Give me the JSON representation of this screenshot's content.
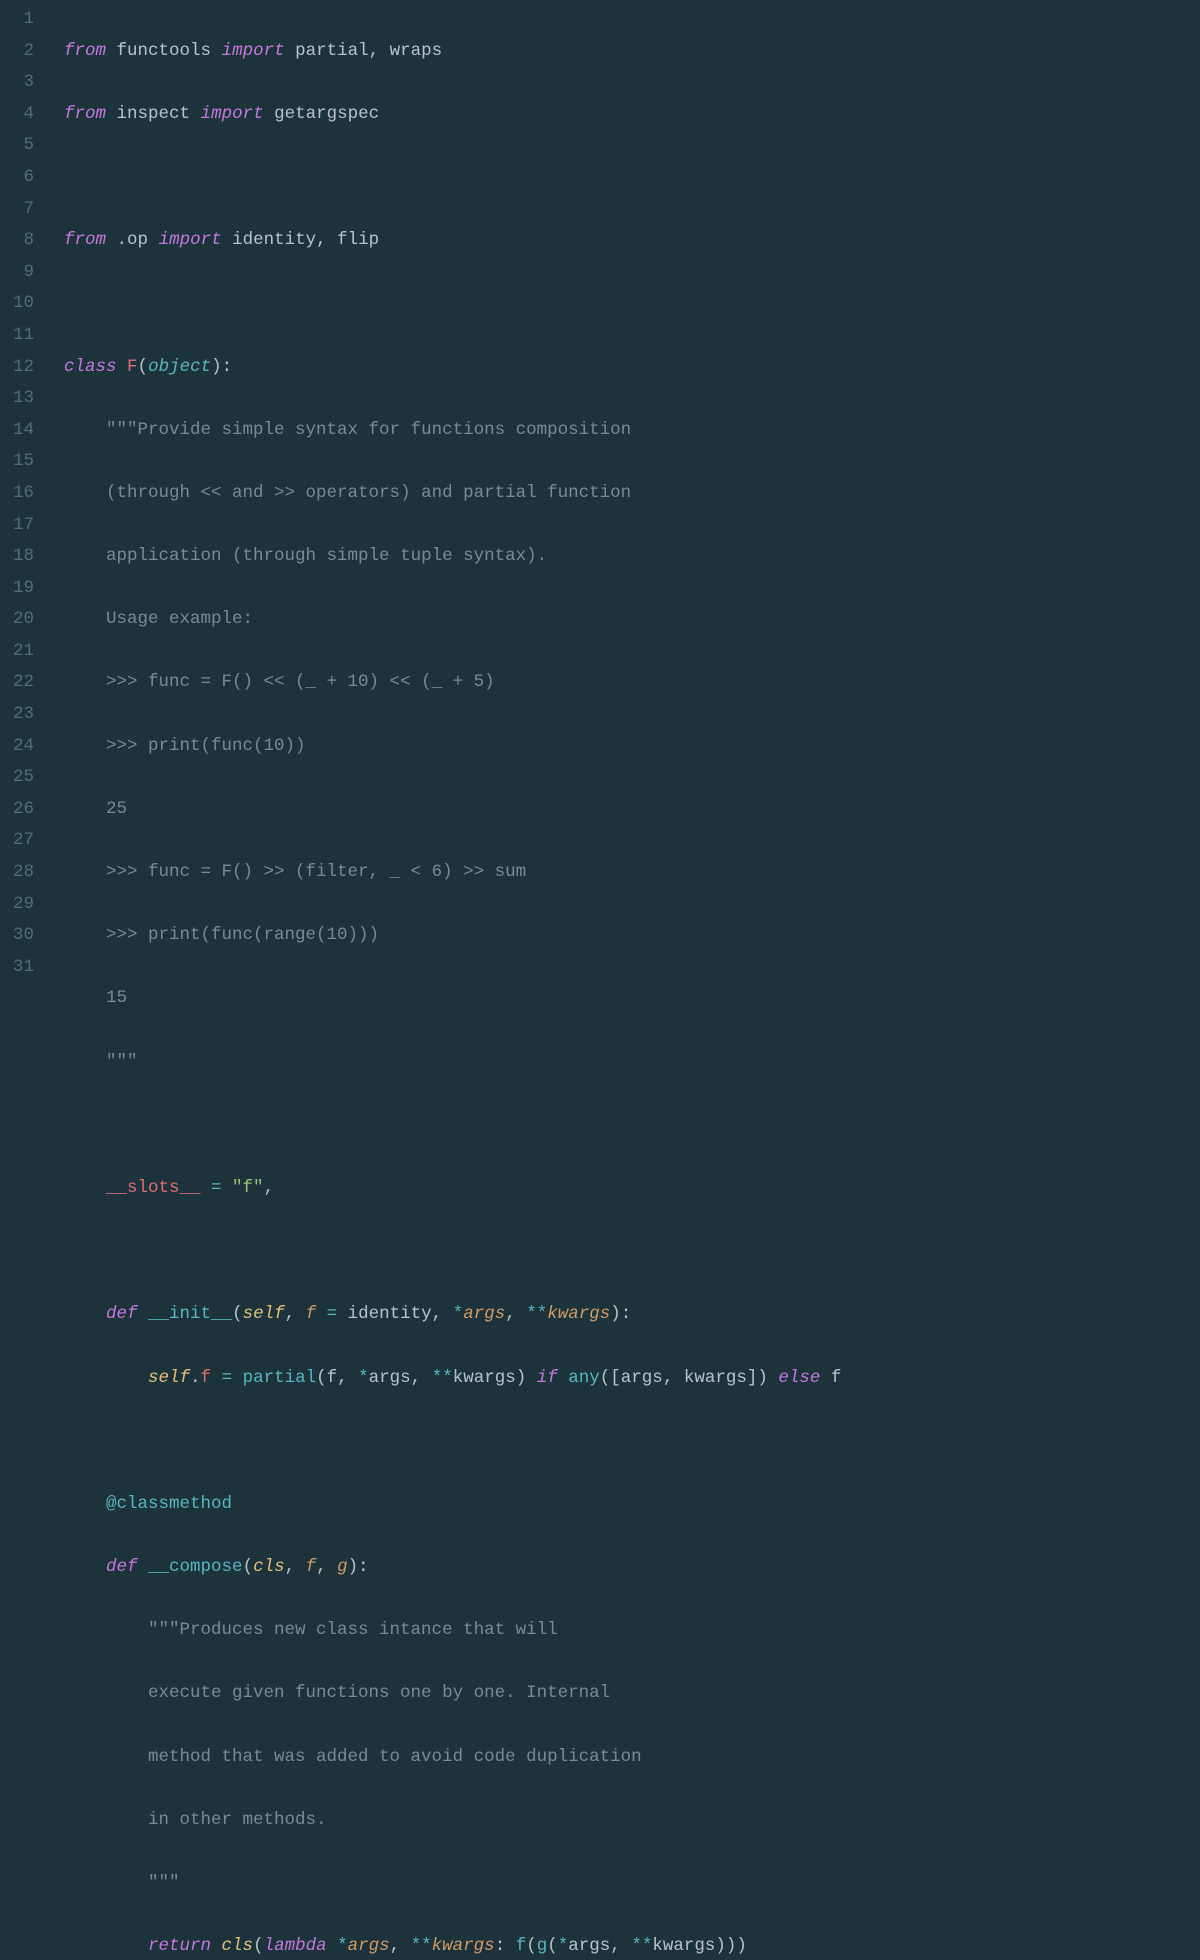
{
  "theme": {
    "background": "#1d333b",
    "gutter_fg": "#516d76",
    "keyword": "#c678dd",
    "function": "#56b6c2",
    "class_name": "#e06c75",
    "param": "#d19a66",
    "self": "#e5c07b",
    "string_doc": "#7a8a91",
    "string": "#98c379"
  },
  "line_numbers": [
    "1",
    "2",
    "3",
    "4",
    "5",
    "6",
    "7",
    "8",
    "9",
    "10",
    "11",
    "12",
    "13",
    "14",
    "15",
    "16",
    "17",
    "18",
    "19",
    "20",
    "21",
    "22",
    "23",
    "24",
    "25",
    "26",
    "27",
    "28",
    "29",
    "30",
    "31"
  ],
  "code_lines": {
    "l1": {
      "text": "from functools import partial, wraps"
    },
    "l2": {
      "text": "from inspect import getargspec"
    },
    "l3": {
      "text": ""
    },
    "l4": {
      "text": "from .op import identity, flip"
    },
    "l5": {
      "text": ""
    },
    "l6": {
      "text": "class F(object):"
    },
    "l7": {
      "text": "    \"\"\"Provide simple syntax for functions composition"
    },
    "l8": {
      "text": "    (through << and >> operators) and partial function"
    },
    "l9": {
      "text": "    application (through simple tuple syntax)."
    },
    "l10": {
      "text": "    Usage example:"
    },
    "l11": {
      "text": "    >>> func = F() << (_ + 10) << (_ + 5)"
    },
    "l12": {
      "text": "    >>> print(func(10))"
    },
    "l13": {
      "text": "    25"
    },
    "l14": {
      "text": "    >>> func = F() >> (filter, _ < 6) >> sum"
    },
    "l15": {
      "text": "    >>> print(func(range(10)))"
    },
    "l16": {
      "text": "    15"
    },
    "l17": {
      "text": "    \"\"\""
    },
    "l18": {
      "text": ""
    },
    "l19": {
      "text": "    __slots__ = \"f\","
    },
    "l20": {
      "text": ""
    },
    "l21": {
      "text": "    def __init__(self, f = identity, *args, **kwargs):"
    },
    "l22": {
      "text": "        self.f = partial(f, *args, **kwargs) if any([args, kwargs]) else f"
    },
    "l23": {
      "text": ""
    },
    "l24": {
      "text": "    @classmethod"
    },
    "l25": {
      "text": "    def __compose(cls, f, g):"
    },
    "l26": {
      "text": "        \"\"\"Produces new class intance that will"
    },
    "l27": {
      "text": "        execute given functions one by one. Internal"
    },
    "l28": {
      "text": "        method that was added to avoid code duplication"
    },
    "l29": {
      "text": "        in other methods."
    },
    "l30": {
      "text": "        \"\"\""
    },
    "l31": {
      "text": "        return cls(lambda *args, **kwargs: f(g(*args, **kwargs)))"
    }
  },
  "tokens": {
    "from": "from",
    "import": "import",
    "class": "class",
    "def": "def",
    "return": "return",
    "if": "if",
    "else": "else",
    "lambda": "lambda",
    "functools": "functools",
    "inspect": "inspect",
    "partial": "partial",
    "wraps": "wraps",
    "getargspec": "getargspec",
    "dot_op": ".op",
    "identity": "identity",
    "flip": "flip",
    "F": "F",
    "object": "object",
    "slots": "__slots__",
    "eq": " = ",
    "f_str": "\"f\"",
    "init": "__init__",
    "self": "self",
    "f": "f",
    "g": "g",
    "args": "args",
    "kwargs": "kwargs",
    "star": "*",
    "dstar": "**",
    "any": "any",
    "classmethod": "@classmethod",
    "compose": "__compose",
    "cls": "cls",
    "doc7": "\"\"\"Provide simple syntax for functions composition",
    "doc8": "(through << and >> operators) and partial function",
    "doc9": "application (through simple tuple syntax).",
    "doc10": "Usage example:",
    "doc11": ">>> func = F() << (_ + 10) << (_ + 5)",
    "doc12": ">>> print(func(10))",
    "doc13": "25",
    "doc14": ">>> func = F() >> (filter, _ < 6) >> sum",
    "doc15": ">>> print(func(range(10)))",
    "doc16": "15",
    "doc17": "\"\"\"",
    "doc26": "\"\"\"Produces new class intance that will",
    "doc27": "execute given functions one by one. Internal",
    "doc28": "method that was added to avoid code duplication",
    "doc29": "in other methods.",
    "doc30": "\"\"\""
  }
}
